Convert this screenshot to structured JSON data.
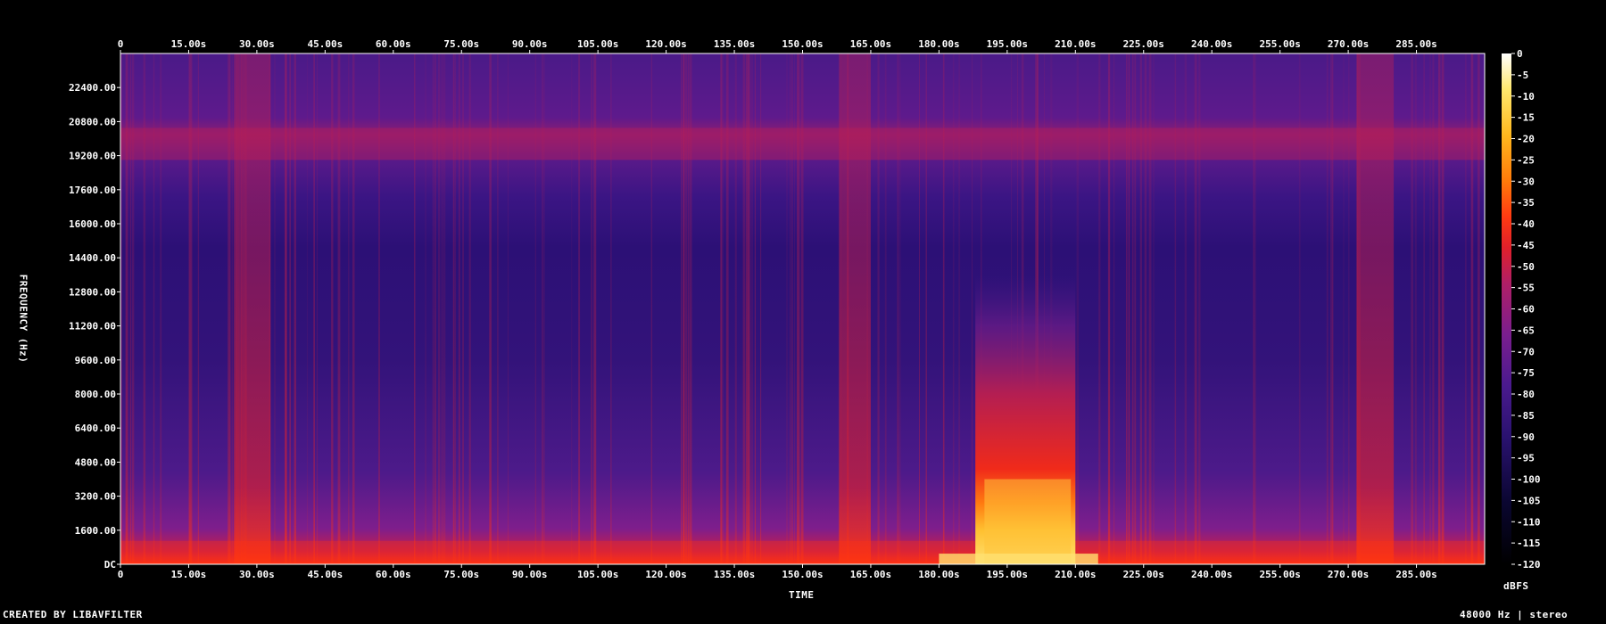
{
  "chart_data": {
    "type": "heatmap",
    "xlabel": "TIME",
    "ylabel": "FREQUENCY (Hz)",
    "x_unit": "s",
    "xlim": [
      0,
      300
    ],
    "ylim": [
      0,
      24000
    ],
    "x_ticks": [
      "0",
      "15.00s",
      "30.00s",
      "45.00s",
      "60.00s",
      "75.00s",
      "90.00s",
      "105.00s",
      "120.00s",
      "135.00s",
      "150.00s",
      "165.00s",
      "180.00s",
      "195.00s",
      "210.00s",
      "225.00s",
      "240.00s",
      "255.00s",
      "270.00s",
      "285.00s"
    ],
    "x_tick_values": [
      0,
      15,
      30,
      45,
      60,
      75,
      90,
      105,
      120,
      135,
      150,
      165,
      180,
      195,
      210,
      225,
      240,
      255,
      270,
      285
    ],
    "y_ticks": [
      "DC",
      "1600.00",
      "3200.00",
      "4800.00",
      "6400.00",
      "8000.00",
      "9600.00",
      "11200.00",
      "12800.00",
      "14400.00",
      "16000.00",
      "17600.00",
      "19200.00",
      "20800.00",
      "22400.00"
    ],
    "y_tick_values": [
      0,
      1600,
      3200,
      4800,
      6400,
      8000,
      9600,
      11200,
      12800,
      14400,
      16000,
      17600,
      19200,
      20800,
      22400
    ],
    "colorbar": {
      "label": "dBFS",
      "ticks": [
        "0",
        "-5",
        "-10",
        "-15",
        "-20",
        "-25",
        "-30",
        "-35",
        "-40",
        "-45",
        "-50",
        "-55",
        "-60",
        "-65",
        "-70",
        "-75",
        "-80",
        "-85",
        "-90",
        "-95",
        "-100",
        "-105",
        "-110",
        "-115",
        "-120"
      ],
      "range": [
        -120,
        0
      ]
    },
    "loud_bands_s": [
      [
        25,
        33
      ],
      [
        158,
        165
      ],
      [
        272,
        280
      ]
    ],
    "loud_event_s": [
      188,
      210
    ],
    "hf_band_hz": [
      19000,
      20500
    ]
  },
  "footer": {
    "left": "CREATED BY LIBAVFILTER",
    "right": "48000 Hz | stereo"
  },
  "colors": {
    "background": "#000000",
    "frame": "#ffffff",
    "palette": [
      "#000000",
      "#0a0630",
      "#2a1270",
      "#4a1a8e",
      "#7a1e8e",
      "#b01f66",
      "#e0202a",
      "#ff3a12",
      "#ff7a0a",
      "#ffb81e",
      "#ffe86e",
      "#ffffff"
    ]
  }
}
